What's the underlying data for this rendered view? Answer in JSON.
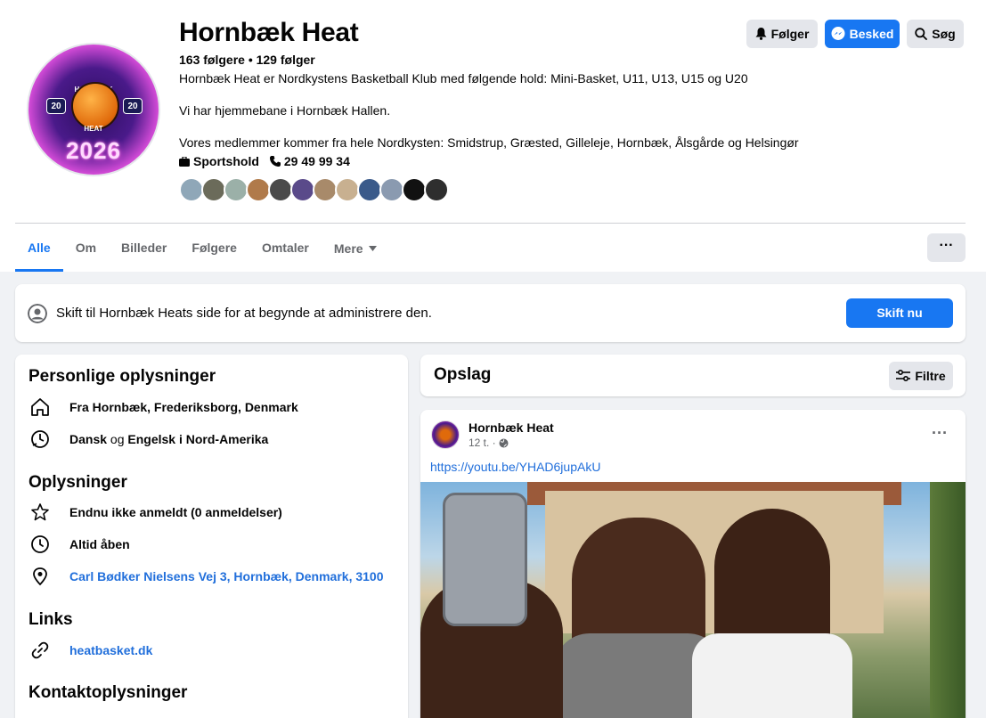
{
  "page": {
    "name": "Hornbæk Heat",
    "follow_stats": "163 følgere • 129 følger",
    "description_lines": [
      "Hornbæk Heat er Nordkystens Basketball Klub med følgende hold: Mini-Basket, U11, U13, U15 og U20",
      "Vi har hjemmebane i Hornbæk Hallen.",
      "Vores medlemmer kommer fra hele Nordkysten: Smidstrup, Græsted, Gilleleje, Hornbæk, Ålsgårde og Helsingør"
    ],
    "category": "Sportshold",
    "phone": "29 49 99 34",
    "profile_badge": {
      "arc_top": "HORNBÆK",
      "arc_bottom": "HEAT",
      "left": "20",
      "right": "20",
      "year": "2026"
    }
  },
  "header_buttons": {
    "following": "Følger",
    "message": "Besked",
    "search": "Søg"
  },
  "follower_avatars": [
    {
      "color": "#8fa7b8",
      "icon": "avatar"
    },
    {
      "color": "#6b6b5a",
      "icon": "avatar"
    },
    {
      "color": "#9bb0a8",
      "icon": "avatar"
    },
    {
      "color": "#b07a4a",
      "icon": "avatar"
    },
    {
      "color": "#4a4a4a",
      "icon": "avatar"
    },
    {
      "color": "#5a4a8a",
      "icon": "avatar"
    },
    {
      "color": "#a88a6a",
      "icon": "avatar"
    },
    {
      "color": "#c8b090",
      "icon": "avatar"
    },
    {
      "color": "#3a5a8a",
      "icon": "avatar"
    },
    {
      "color": "#8a9ab0",
      "icon": "avatar"
    },
    {
      "color": "#111111",
      "icon": "avatar"
    },
    {
      "color": "#2e2e2e",
      "icon": "avatar"
    }
  ],
  "tabs": [
    {
      "label": "Alle",
      "active": true
    },
    {
      "label": "Om",
      "active": false
    },
    {
      "label": "Billeder",
      "active": false
    },
    {
      "label": "Følgere",
      "active": false
    },
    {
      "label": "Omtaler",
      "active": false
    },
    {
      "label": "Mere",
      "active": false
    }
  ],
  "more_options_label": "···",
  "switch_banner": {
    "text": "Skift til Hornbæk Heats side for at begynde at administrere den.",
    "button": "Skift nu"
  },
  "personal_info": {
    "title": "Personlige oplysninger",
    "location": "Fra Hornbæk, Frederiksborg, Denmark",
    "lang_a": "Dansk",
    "lang_sep": " og ",
    "lang_b": "Engelsk i Nord-Amerika"
  },
  "info": {
    "title": "Oplysninger",
    "rating": "Endnu ikke anmeldt (0 anmeldelser)",
    "hours": "Altid åben",
    "address": "Carl Bødker Nielsens Vej 3, Hornbæk, Denmark, 3100"
  },
  "links": {
    "title": "Links",
    "website": "heatbasket.dk"
  },
  "contact": {
    "title": "Kontaktoplysninger"
  },
  "posts_header": {
    "title": "Opslag",
    "filter": "Filtre"
  },
  "post": {
    "author": "Hornbæk Heat",
    "time": "12 t. ·",
    "link": "https://youtu.be/YHAD6jupAkU",
    "menu": "···"
  },
  "colors": {
    "accent": "#1877f2",
    "link": "#216fdb",
    "background": "#f0f2f5",
    "muted": "#65676b"
  }
}
